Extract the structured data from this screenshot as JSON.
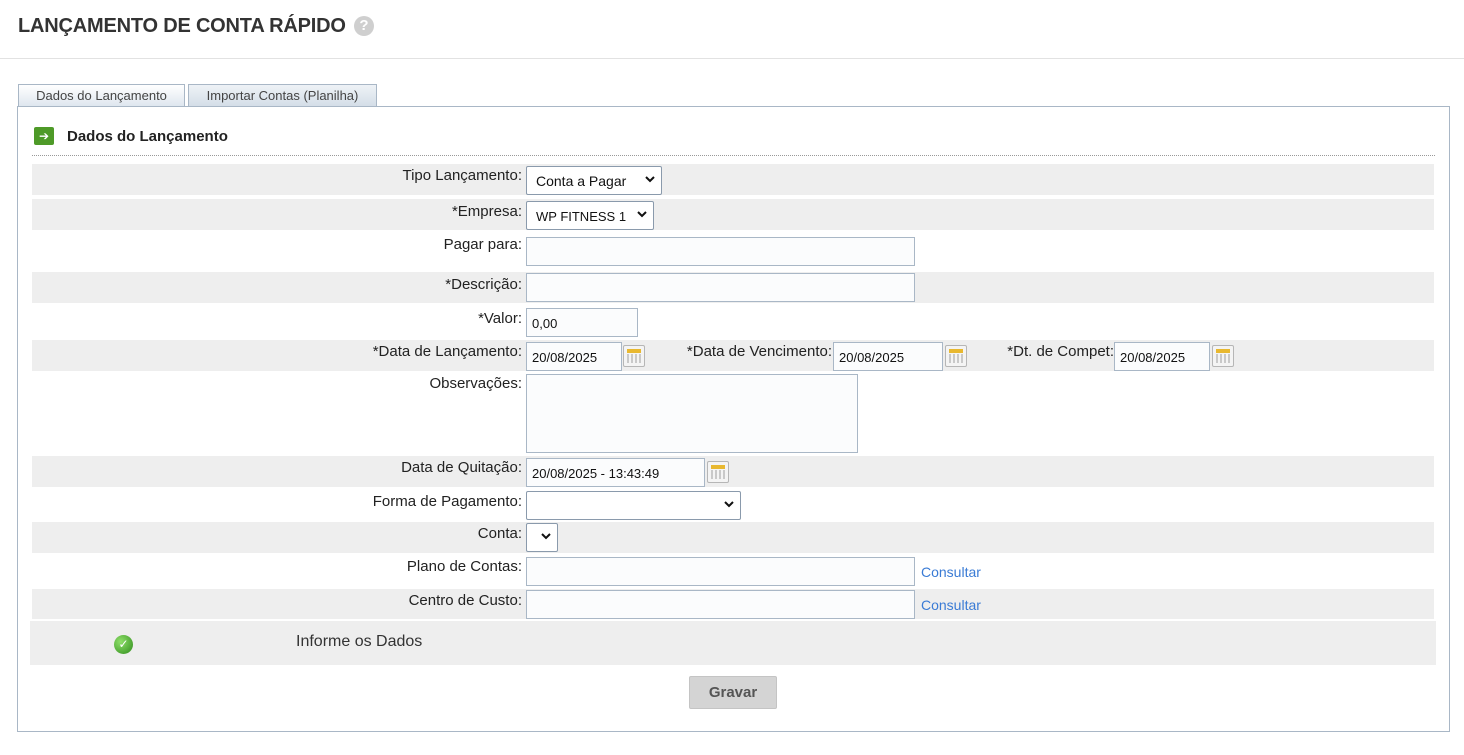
{
  "header": {
    "title": "LANÇAMENTO DE CONTA RÁPIDO",
    "help_glyph": "?"
  },
  "tabs": [
    {
      "label": "Dados do Lançamento",
      "active": true
    },
    {
      "label": "Importar Contas (Planilha)",
      "active": false
    }
  ],
  "section": {
    "title": "Dados do Lançamento",
    "icon_glyph": "➔"
  },
  "form": {
    "tipo_lancamento": {
      "label": "Tipo Lançamento:",
      "value": "Conta a Pagar"
    },
    "empresa": {
      "label": "*Empresa:",
      "value": "WP FITNESS 1"
    },
    "pagar_para": {
      "label": "Pagar para:",
      "value": ""
    },
    "descricao": {
      "label": "*Descrição:",
      "value": ""
    },
    "valor": {
      "label": "*Valor:",
      "value": "0,00"
    },
    "data_lancamento": {
      "label": "*Data de Lançamento:",
      "value": "20/08/2025"
    },
    "data_vencimento": {
      "label": "*Data de Vencimento:",
      "value": "20/08/2025"
    },
    "dt_compet": {
      "label": "*Dt. de Compet:",
      "value": "20/08/2025"
    },
    "observacoes": {
      "label": "Observações:",
      "value": ""
    },
    "data_quitacao": {
      "label": "Data de Quitação:",
      "value": "20/08/2025 - 13:43:49"
    },
    "forma_pagamento": {
      "label": "Forma de Pagamento:",
      "value": ""
    },
    "conta": {
      "label": "Conta:",
      "value": ""
    },
    "plano_contas": {
      "label": "Plano de Contas:",
      "value": "",
      "link": "Consultar"
    },
    "centro_custo": {
      "label": "Centro de Custo:",
      "value": "",
      "link": "Consultar"
    }
  },
  "status": {
    "text": "Informe os Dados",
    "icon_glyph": "✓"
  },
  "actions": {
    "save_label": "Gravar"
  },
  "colors": {
    "link": "#3a7bd5",
    "row_shade": "#eeeeee",
    "ok_green": "#2e8b1a",
    "section_icon": "#4e9a28"
  }
}
